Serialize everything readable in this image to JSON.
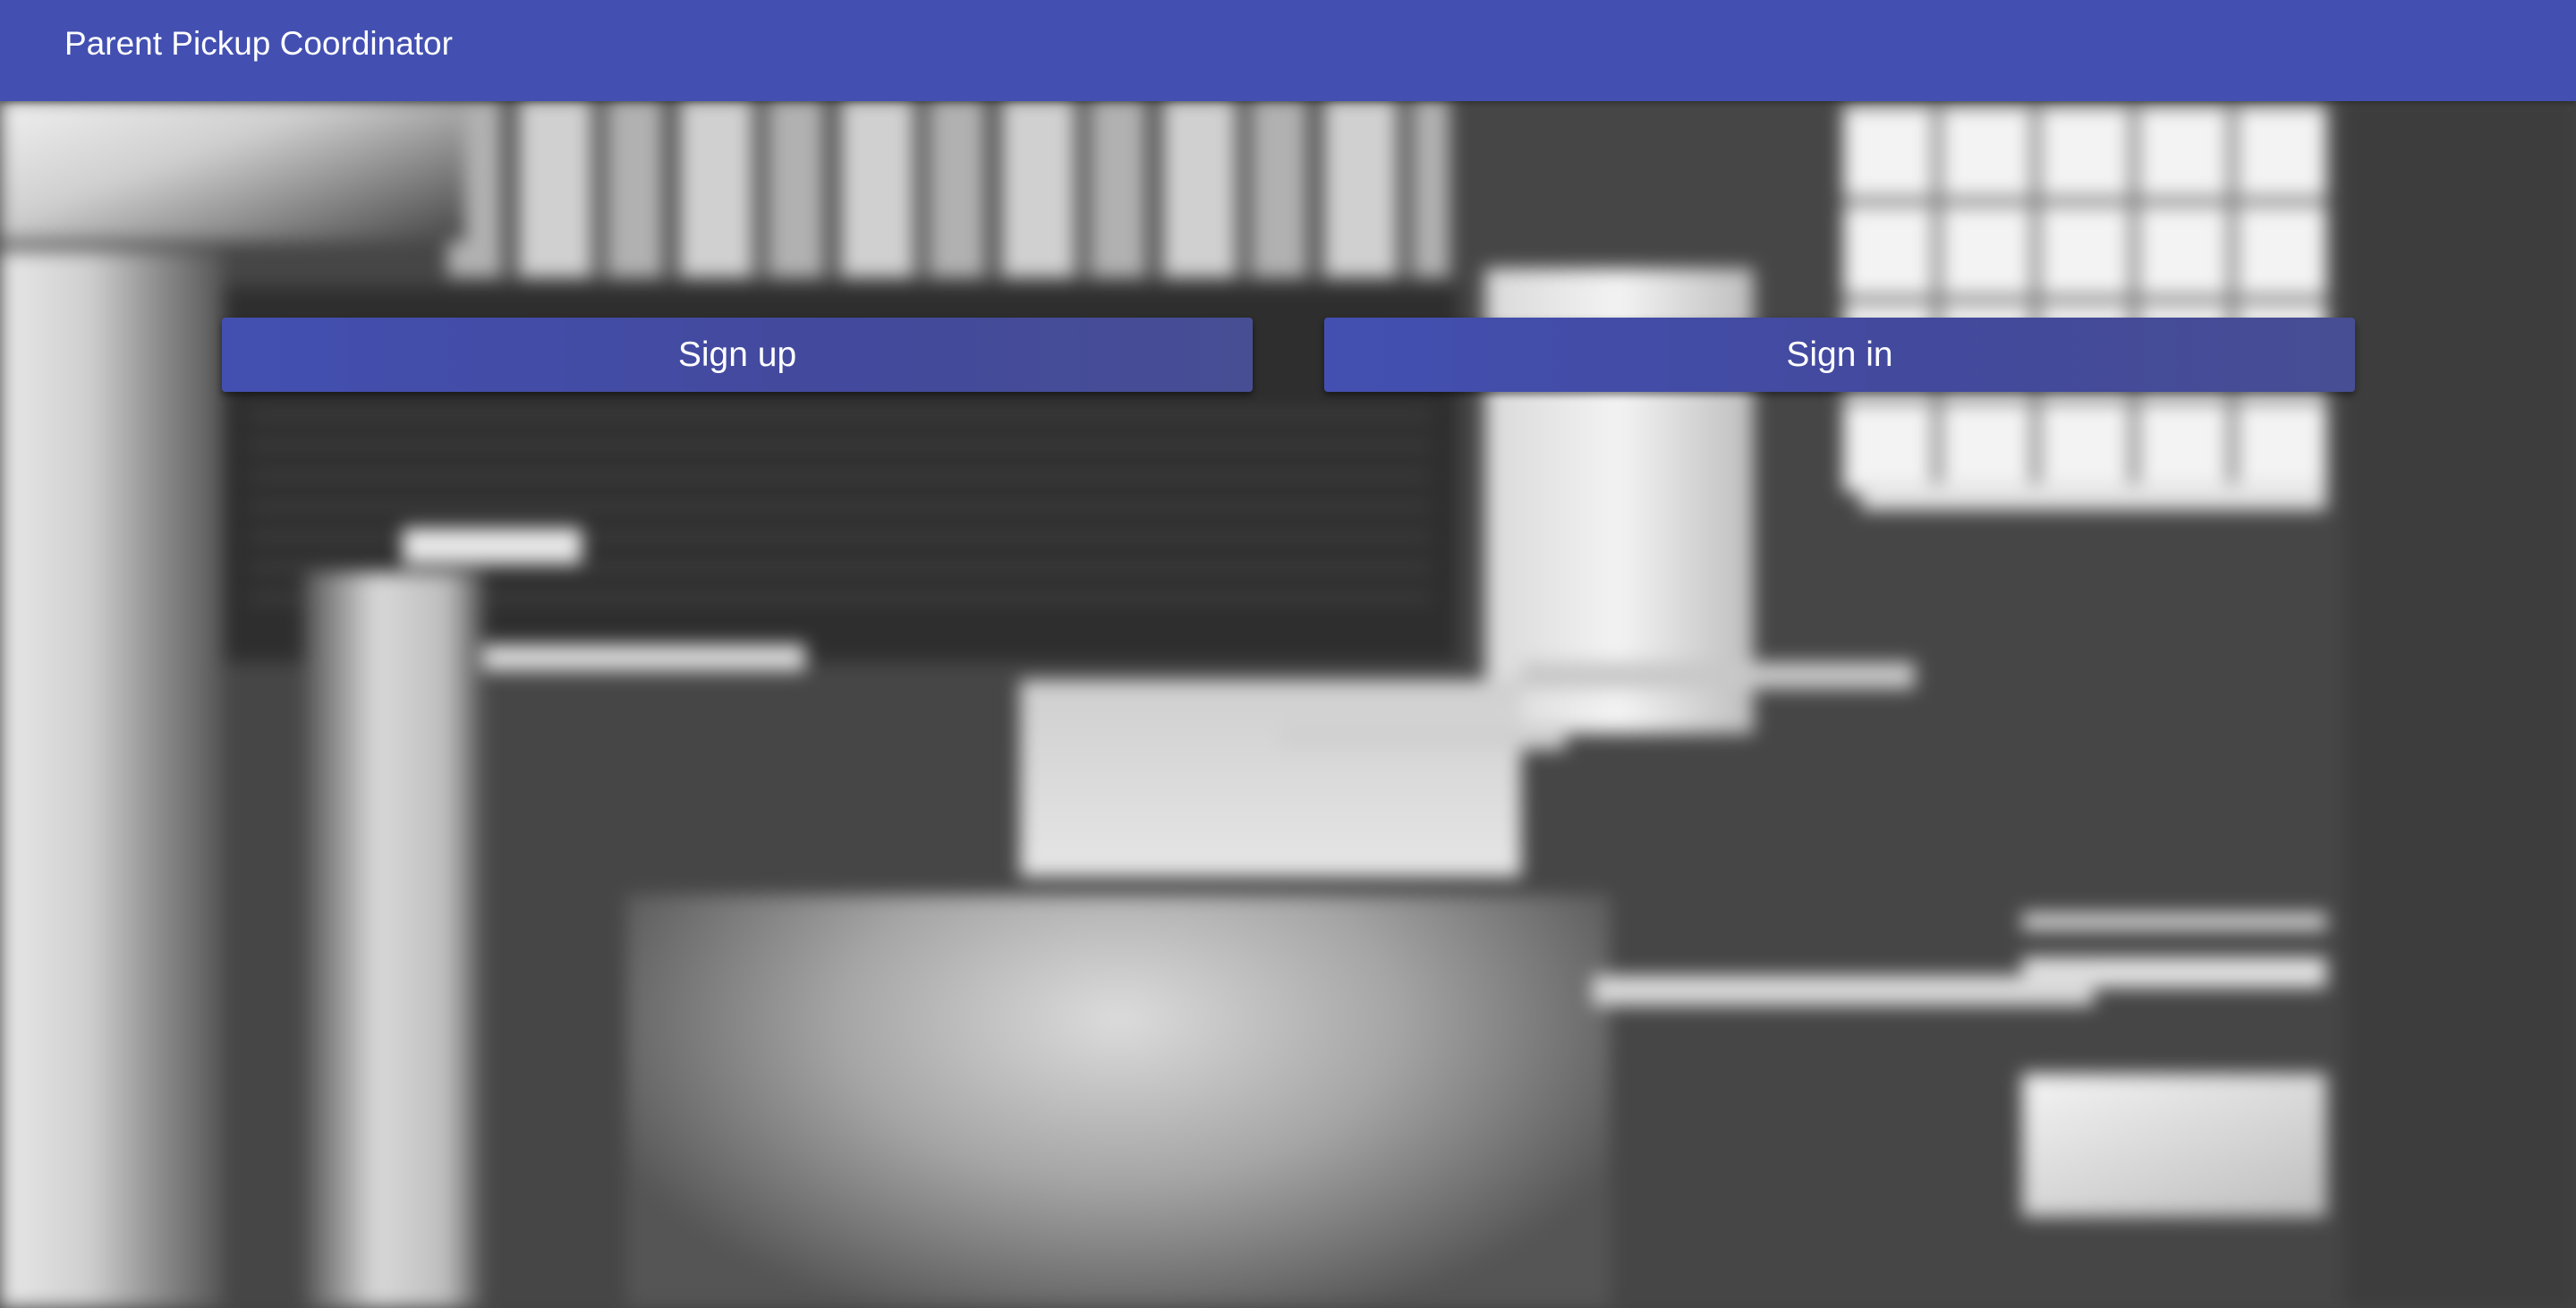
{
  "header": {
    "title": "Parent Pickup Coordinator"
  },
  "actions": {
    "sign_up_label": "Sign up",
    "sign_in_label": "Sign in"
  },
  "colors": {
    "primary": "#4350b1",
    "background": "#444444",
    "text_on_primary": "#ffffff"
  }
}
